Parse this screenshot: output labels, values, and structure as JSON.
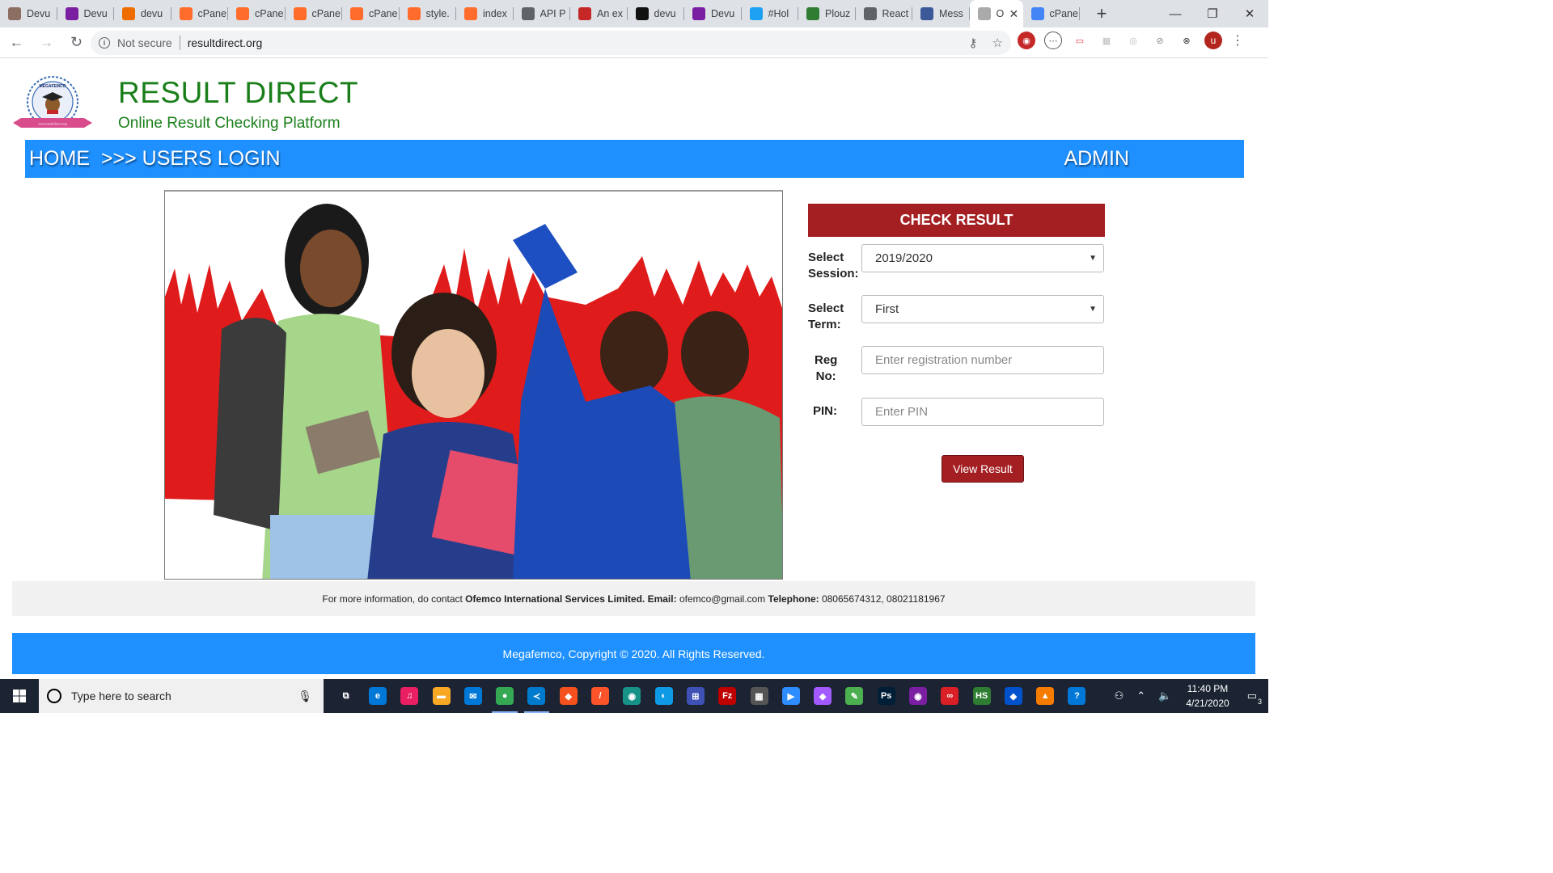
{
  "browser": {
    "tabs": [
      {
        "title": "Devu",
        "color": "#8d6e63"
      },
      {
        "title": "Devu",
        "color": "#7b1fa2"
      },
      {
        "title": "devu",
        "color": "#ef6c00"
      },
      {
        "title": "cPane",
        "color": "#ff6c2c"
      },
      {
        "title": "cPane",
        "color": "#ff6c2c"
      },
      {
        "title": "cPane",
        "color": "#ff6c2c"
      },
      {
        "title": "cPane",
        "color": "#ff6c2c"
      },
      {
        "title": "style.",
        "color": "#ff6c2c"
      },
      {
        "title": "index",
        "color": "#ff6c2c"
      },
      {
        "title": "API P",
        "color": "#5f6368"
      },
      {
        "title": "An ex",
        "color": "#c62828"
      },
      {
        "title": "devu",
        "color": "#111111"
      },
      {
        "title": "Devu",
        "color": "#7b1fa2"
      },
      {
        "title": "#Hol",
        "color": "#1da1f2"
      },
      {
        "title": "Plouz",
        "color": "#2e7d32"
      },
      {
        "title": "React",
        "color": "#5f6368"
      },
      {
        "title": "Mess",
        "color": "#3b5998"
      }
    ],
    "active_tab": {
      "title": "O"
    },
    "last_tab": {
      "title": "cPane"
    },
    "not_secure_label": "Not secure",
    "url": "resultdirect.org",
    "profile_initial": "u"
  },
  "site": {
    "title": "RESULT DIRECT",
    "subtitle": "Online Result Checking Platform",
    "logo_top_text": "MEGAFEMCO",
    "logo_bottom_text": "www.resultdirect.org"
  },
  "nav": {
    "breadcrumb": "HOME  >>> USERS LOGIN",
    "admin_label": "ADMIN"
  },
  "form": {
    "heading": "CHECK RESULT",
    "session_label_1": "Select",
    "session_label_2": "Session:",
    "session_value": "2019/2020",
    "term_label_1": "Select",
    "term_label_2": "Term:",
    "term_value": "First",
    "reg_label_1": "Reg",
    "reg_label_2": "No:",
    "reg_placeholder": "Enter registration number",
    "pin_label": "PIN:",
    "pin_placeholder": "Enter PIN",
    "submit_label": "View Result"
  },
  "info": {
    "prefix": "For more information, do contact ",
    "company": "Ofemco International Services Limited.",
    "email_label": " Email:",
    "email": " ofemco@gmail.com ",
    "phone_label": "Telephone:",
    "phones": " 08065674312, 08021181967"
  },
  "footer": {
    "copyright": "Megafemco, Copyright © 2020. All Rights Reserved."
  },
  "taskbar": {
    "search_placeholder": "Type here to search",
    "time": "11:40 PM",
    "date": "4/21/2020",
    "notification_count": "3",
    "apps": [
      {
        "name": "task-view",
        "color": "#1c2433",
        "glyph": "⧉"
      },
      {
        "name": "edge",
        "color": "#0078d7",
        "glyph": "e"
      },
      {
        "name": "itunes",
        "color": "#e91e63",
        "glyph": "♫"
      },
      {
        "name": "file-explorer",
        "color": "#f9a825",
        "glyph": "▬"
      },
      {
        "name": "mail",
        "color": "#0078d7",
        "glyph": "✉"
      },
      {
        "name": "chrome",
        "color": "#34a853",
        "glyph": "●"
      },
      {
        "name": "vscode",
        "color": "#007acc",
        "glyph": "≺"
      },
      {
        "name": "git",
        "color": "#f4511e",
        "glyph": "◆"
      },
      {
        "name": "brave",
        "color": "#fb542b",
        "glyph": "/"
      },
      {
        "name": "gitkraken",
        "color": "#179287",
        "glyph": "◉"
      },
      {
        "name": "edge-beta",
        "color": "#0f9ae6",
        "glyph": "◐"
      },
      {
        "name": "network",
        "color": "#3f51b5",
        "glyph": "⊞"
      },
      {
        "name": "filezilla",
        "color": "#bf0000",
        "glyph": "Fz"
      },
      {
        "name": "shell",
        "color": "#555555",
        "glyph": "▦"
      },
      {
        "name": "zoom",
        "color": "#2d8cff",
        "glyph": "▶"
      },
      {
        "name": "figma",
        "color": "#a259ff",
        "glyph": "◆"
      },
      {
        "name": "paint",
        "color": "#4caf50",
        "glyph": "✎"
      },
      {
        "name": "photoshop",
        "color": "#001e36",
        "glyph": "Ps"
      },
      {
        "name": "podcast",
        "color": "#7b1fa2",
        "glyph": "◉"
      },
      {
        "name": "creative-cloud",
        "color": "#da1f26",
        "glyph": "∞"
      },
      {
        "name": "hotspot",
        "color": "#2e7d32",
        "glyph": "HS"
      },
      {
        "name": "sourcetree",
        "color": "#0052cc",
        "glyph": "◆"
      },
      {
        "name": "vlc",
        "color": "#f57c00",
        "glyph": "▲"
      },
      {
        "name": "help",
        "color": "#0078d7",
        "glyph": "?"
      }
    ]
  }
}
